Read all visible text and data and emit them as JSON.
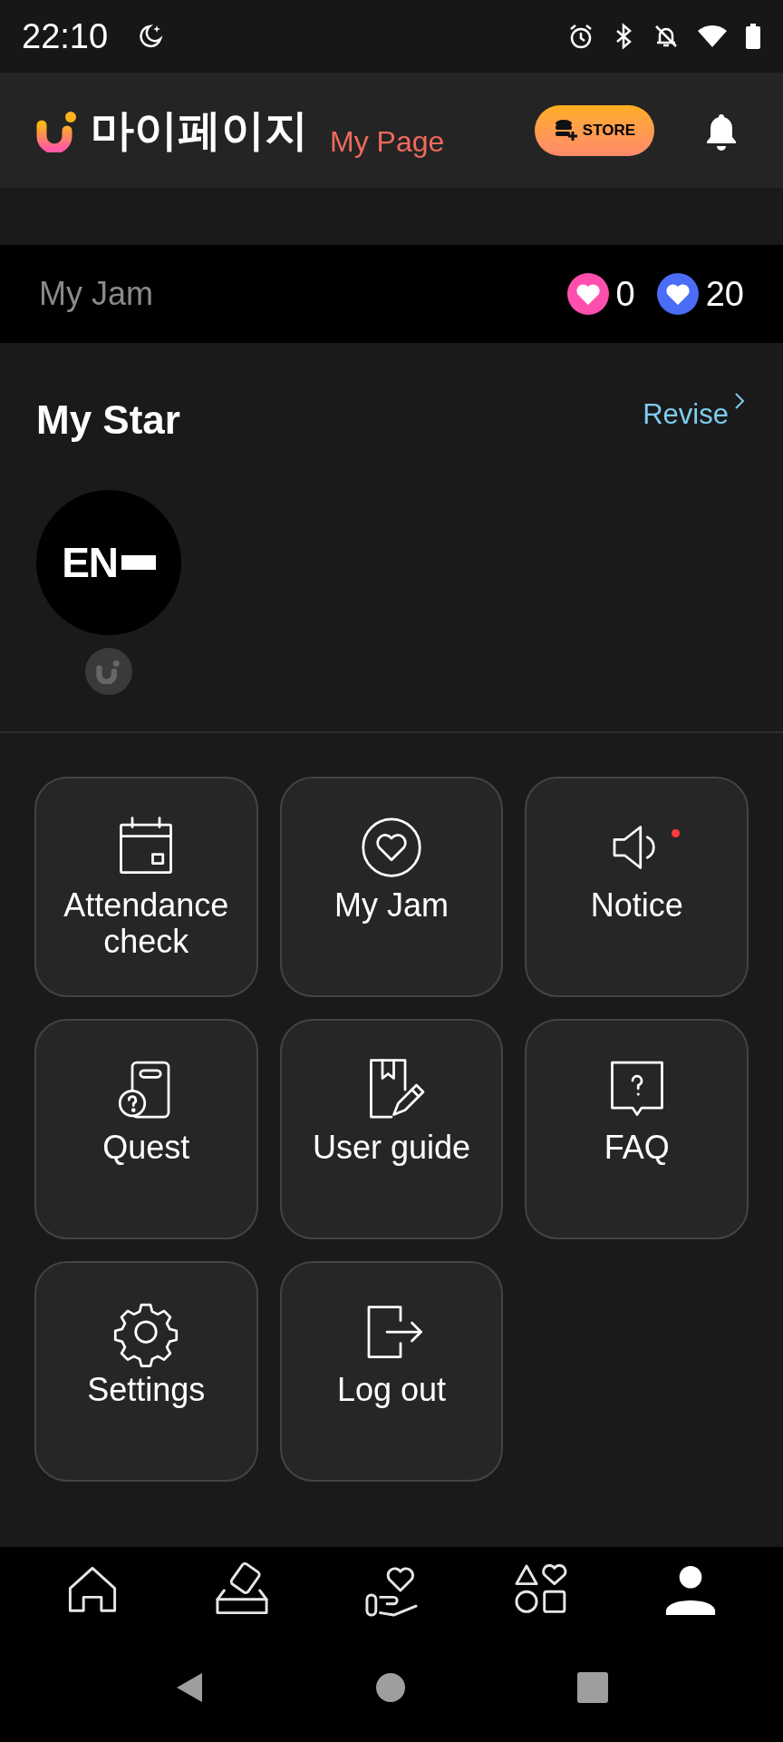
{
  "status_bar": {
    "time": "22:10"
  },
  "header": {
    "title": "마이페이지",
    "subtitle": "My Page",
    "store_button": "STORE"
  },
  "jam": {
    "label": "My Jam",
    "counts": [
      {
        "value": "0",
        "color": "#ff4fae"
      },
      {
        "value": "20",
        "color": "#4a6cf7"
      }
    ]
  },
  "my_star": {
    "title": "My Star",
    "revise": "Revise",
    "stars": [
      {
        "logo": "EN"
      }
    ]
  },
  "menu": [
    {
      "kind": "calendar",
      "label": "Attendance check",
      "badge": false
    },
    {
      "kind": "heart",
      "label": "My Jam",
      "badge": false
    },
    {
      "kind": "speaker",
      "label": "Notice",
      "badge": true
    },
    {
      "kind": "quest",
      "label": "Quest",
      "badge": false
    },
    {
      "kind": "guide",
      "label": "User guide",
      "badge": false
    },
    {
      "kind": "faq",
      "label": "FAQ",
      "badge": false
    },
    {
      "kind": "settings",
      "label": "Settings",
      "badge": false
    },
    {
      "kind": "logout",
      "label": "Log out",
      "badge": false
    }
  ],
  "bottom_nav": [
    {
      "kind": "home",
      "selected": false
    },
    {
      "kind": "vote",
      "selected": false
    },
    {
      "kind": "donate",
      "selected": false
    },
    {
      "kind": "shapes",
      "selected": false
    },
    {
      "kind": "profile",
      "selected": true
    }
  ]
}
